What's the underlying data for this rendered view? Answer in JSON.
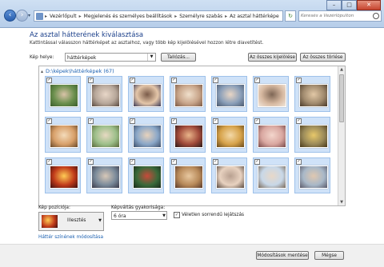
{
  "address": {
    "crumbs": [
      "Vezérlőpult",
      "Megjelenés és személyes beállítások",
      "Személyre szabás",
      "Az asztal háttérképe"
    ],
    "search_placeholder": "Keresés a Vezérlőpulton"
  },
  "window_buttons": {
    "minimize": "–",
    "maximize": "□",
    "close": "✕"
  },
  "header": {
    "title": "Az asztal hátterének kiválasztása",
    "subtitle": "Kattintással válasszon háttérképet az asztalhoz, vagy több kép kijelölésével hozzon létre diavetítést."
  },
  "location": {
    "label": "Kép helye:",
    "value": "háttérképek",
    "browse": "Tallózás...",
    "select_all": "Az összes kijelölése",
    "clear_all": "Az összes törlése"
  },
  "gallery": {
    "group_label": "D:\\képek\\háttérképek (67)",
    "tiles": [
      {
        "checked": "✓",
        "colors": [
          "#6a8f4d",
          "#d9c3a8",
          "#3c5e2d"
        ]
      },
      {
        "checked": "✓",
        "colors": [
          "#b7a79a",
          "#e8d7c8",
          "#5a4a40"
        ]
      },
      {
        "checked": "✓",
        "colors": [
          "#e4c6a9",
          "#7a5b49",
          "#3b3b5a"
        ]
      },
      {
        "checked": "✓",
        "colors": [
          "#c8a58a",
          "#f0e0cc",
          "#7d5a45"
        ]
      },
      {
        "checked": "✓",
        "colors": [
          "#8b9fb9",
          "#e9d6c5",
          "#4b5a70"
        ]
      },
      {
        "checked": "✓",
        "colors": [
          "#d6b8a0",
          "#7e6655",
          "#f2e6da"
        ]
      },
      {
        "checked": "✓",
        "colors": [
          "#a08a6e",
          "#e2c8a6",
          "#4a3a2a"
        ]
      },
      {
        "checked": "✓",
        "colors": [
          "#d8a06a",
          "#f3dbba",
          "#6a4a2a"
        ]
      },
      {
        "checked": "✓",
        "colors": [
          "#9dbf8a",
          "#e7d9c2",
          "#5a6a3a"
        ]
      },
      {
        "checked": "✓",
        "colors": [
          "#8aa7c8",
          "#e8d2bc",
          "#3e4f6a"
        ]
      },
      {
        "checked": "✓",
        "colors": [
          "#a04a3a",
          "#e9b58a",
          "#2a1a1a"
        ]
      },
      {
        "checked": "✓",
        "colors": [
          "#d6a24a",
          "#f3d9a8",
          "#6a4a1a"
        ]
      },
      {
        "checked": "✓",
        "colors": [
          "#d9a7a0",
          "#f3d6cc",
          "#7a4a4a"
        ]
      },
      {
        "checked": "✓",
        "colors": [
          "#9a8a5a",
          "#e8c86a",
          "#4a3a1a"
        ]
      },
      {
        "checked": "✓",
        "colors": [
          "#c03a1a",
          "#ffcc55",
          "#401010"
        ]
      },
      {
        "checked": "✓",
        "colors": [
          "#7a8a9a",
          "#d8c8b8",
          "#3a3a4a"
        ]
      },
      {
        "checked": "✓",
        "colors": [
          "#3a6a3a",
          "#c84a3a",
          "#1a2a1a"
        ]
      },
      {
        "checked": "✓",
        "colors": [
          "#b88a5a",
          "#e8c8a0",
          "#5a3a2a"
        ]
      },
      {
        "checked": "✓",
        "colors": [
          "#e8d2c0",
          "#b8a090",
          "#5a4a40"
        ]
      },
      {
        "checked": "✓",
        "colors": [
          "#c8d8e8",
          "#e8d8c8",
          "#7a6a5a"
        ]
      },
      {
        "checked": "✓",
        "colors": [
          "#a8b8c8",
          "#e0c8b0",
          "#5a5a6a"
        ]
      }
    ]
  },
  "position": {
    "label": "Kép pozíciója:",
    "value": "Illesztés"
  },
  "frequency": {
    "label": "Képváltás gyakorisága:",
    "value": "6 óra"
  },
  "shuffle": {
    "label": "Véletlen sorrendű lejátszás",
    "checked": "✓"
  },
  "color_link": "Háttér színének módosítása",
  "footer": {
    "save": "Módosítások mentése",
    "cancel": "Mégse"
  }
}
